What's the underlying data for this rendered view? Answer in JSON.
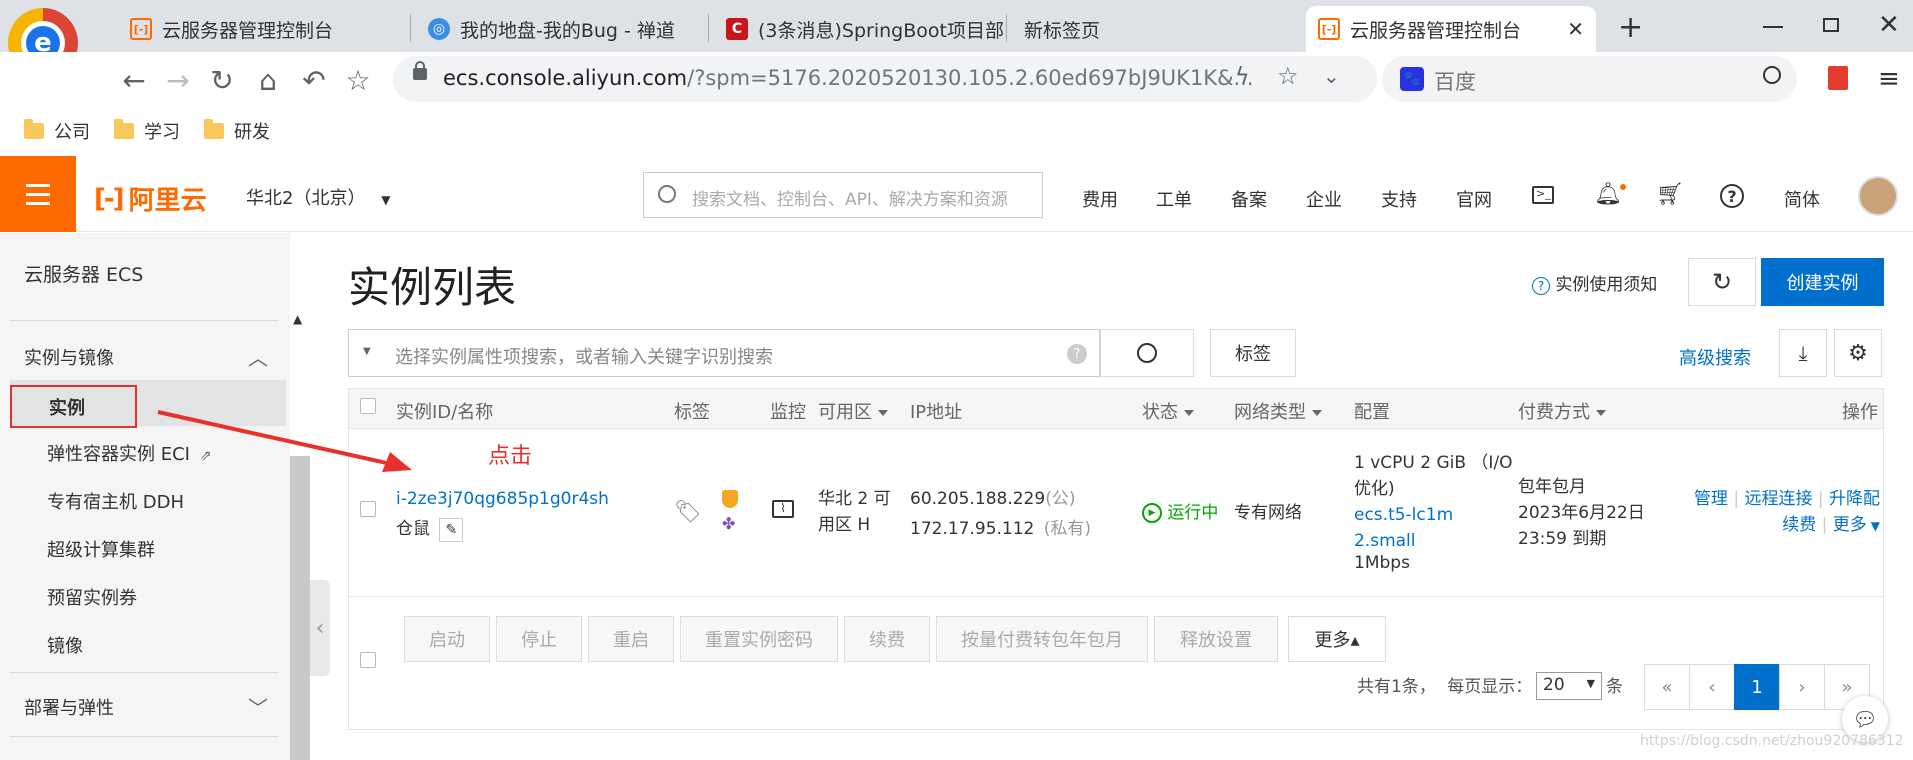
{
  "browser": {
    "tabs": [
      {
        "title": "云服务器管理控制台",
        "icon": "aliyun-icon"
      },
      {
        "title": "我的地盘-我的Bug - 禅道",
        "icon": "zentao-icon"
      },
      {
        "title": "(3条消息)SpringBoot项目部",
        "icon": "csdn-icon"
      },
      {
        "title": "新标签页",
        "icon": ""
      },
      {
        "title": "云服务器管理控制台",
        "icon": "aliyun-icon"
      }
    ],
    "url_host": "ecs.console.aliyun.com",
    "url_rest": "/?spm=5176.2020520130.105.2.60ed697bJ9UK1K&...",
    "search_placeholder": "百度",
    "bookmarks": [
      "公司",
      "学习",
      "研发"
    ]
  },
  "header": {
    "logo_text": "阿里云",
    "region": "华北2（北京）",
    "search_placeholder": "搜索文档、控制台、API、解决方案和资源",
    "nav": [
      "费用",
      "工单",
      "备案",
      "企业",
      "支持",
      "官网"
    ],
    "lang": "简体"
  },
  "sidebar": {
    "product": "云服务器 ECS",
    "group1": "实例与镜像",
    "items": [
      {
        "label": "实例",
        "active": true
      },
      {
        "label": "弹性容器实例 ECI",
        "external": true
      },
      {
        "label": "专有宿主机 DDH"
      },
      {
        "label": "超级计算集群"
      },
      {
        "label": "预留实例券"
      },
      {
        "label": "镜像"
      }
    ],
    "group2": "部署与弹性"
  },
  "main": {
    "title": "实例列表",
    "help_link": "实例使用须知",
    "create_button": "创建实例",
    "filter_placeholder": "选择实例属性项搜索，或者输入关键字识别搜索",
    "tag_button": "标签",
    "advanced_search": "高级搜索",
    "columns": [
      "实例ID/名称",
      "标签",
      "监控",
      "可用区",
      "IP地址",
      "状态",
      "网络类型",
      "配置",
      "付费方式",
      "操作"
    ],
    "annotation": "点击",
    "row": {
      "id": "i-2ze3j70qg685p1g0r4sh",
      "name": "仓鼠",
      "zone": "华北 2 可用区 H",
      "ip_public": "60.205.188.229",
      "ip_public_tag": "(公)",
      "ip_private": "172.17.95.112",
      "ip_private_tag": "(私有)",
      "status": "运行中",
      "network": "专有网络",
      "config_line1": "1 vCPU 2 GiB （I/O优化)",
      "config_link": "ecs.t5-lc1m2.small",
      "config_bw": "1Mbps",
      "billing_type": "包年包月",
      "billing_expire": "2023年6月22日 23:59 到期",
      "actions": [
        "管理",
        "远程连接",
        "升降配",
        "续费",
        "更多"
      ]
    },
    "batch_buttons": [
      "启动",
      "停止",
      "重启",
      "重置实例密码",
      "续费",
      "按量付费转包年包月",
      "释放设置",
      "更多▴"
    ],
    "pager": {
      "total_text": "共有1条，",
      "per_page_label": "每页显示：",
      "per_page": "20",
      "per_page_unit": "条",
      "pages": [
        "«",
        "‹",
        "1",
        "›",
        "»"
      ],
      "current": "1"
    },
    "watermark": "https://blog.csdn.net/zhou920786312"
  },
  "colors": {
    "accent": "#ff6a00",
    "link": "#0070cc",
    "primary_btn": "#0070cc",
    "running": "#00a700",
    "annotation_red": "#e8312d"
  }
}
